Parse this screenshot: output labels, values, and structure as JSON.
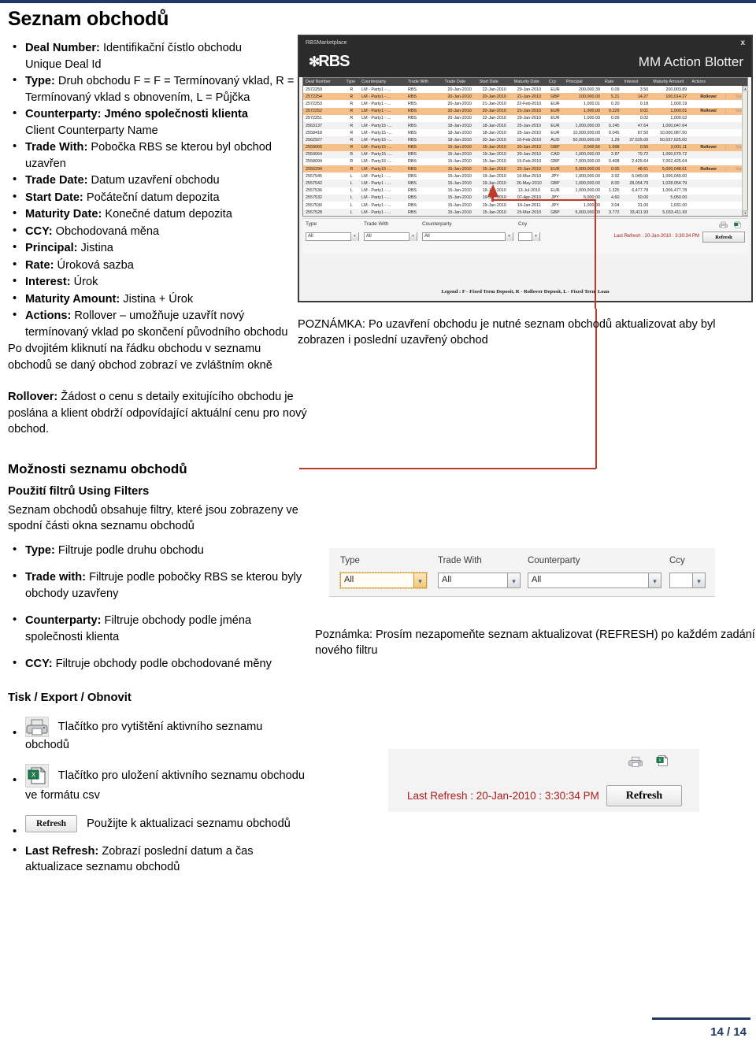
{
  "document": {
    "title": "Seznam obchodů",
    "page_number": "14 / 14"
  },
  "deal_list_bullets": [
    {
      "term": "Deal Number:",
      "desc": " Identifikační čístlo obchodu",
      "extra": "Unique Deal Id"
    },
    {
      "term": "Type:",
      "desc": " Druh obchodu F = F = Termínovaný vklad, R = Termínovaný vklad s obnovením, L = Půjčka",
      "extra": ""
    },
    {
      "term": "Counterparty: Jméno společnosti klienta",
      "desc": "",
      "extra": "Client Counterparty Name"
    },
    {
      "term": "Trade With:",
      "desc": " Pobočka RBS se kterou byl obchod uzavřen",
      "extra": ""
    },
    {
      "term": "Trade Date:",
      "desc": " Datum uzavření obchodu",
      "extra": ""
    },
    {
      "term": "Start Date:",
      "desc": " Počáteční datum depozita",
      "extra": ""
    },
    {
      "term": "Maturity Date:",
      "desc": " Konečné datum depozita",
      "extra": ""
    },
    {
      "term": "CCY:",
      "desc": " Obchodovaná měna",
      "extra": ""
    },
    {
      "term": "Principal:",
      "desc": " Jistina",
      "extra": ""
    },
    {
      "term": "Rate:",
      "desc": " Úroková sazba",
      "extra": ""
    },
    {
      "term": "Interest:",
      "desc": " Úrok",
      "extra": ""
    },
    {
      "term": "Maturity Amount:",
      "desc": " Jistina + Úrok",
      "extra": ""
    },
    {
      "term": "Actions:",
      "desc": " Rollover – umožňuje uzavřít nový termínovaný vklad po skončení původního obchodu",
      "extra": ""
    }
  ],
  "doubleclick_note": "Po dvojitém kliknutí na řádku obchodu v seznamu obchodů se daný obchod zobrazí ve zvláštním okně",
  "rollover_note": {
    "term": "Rollover:",
    "text": " Žádost o cenu s detaily exitujícího obchodu je poslána a klient obdrží odpovídající aktuální cenu pro nový obchod."
  },
  "note_top_right": "POZNÁMKA: Po uzavření obchodu je nutné seznam obchodů aktualizovat aby byl zobrazen i poslední uzavřený obchod",
  "options_section": {
    "heading": "Možnosti seznamu obchodů",
    "subheading": "Použití filtrů Using Filters",
    "intro": "Seznam obchodů obsahuje filtry, které jsou zobrazeny ve spodní části okna seznamu obchodů",
    "bullets": [
      {
        "term": "Type:",
        "desc": " Filtruje podle druhu obchodu"
      },
      {
        "term": "Trade with:",
        "desc": " Filtruje podle pobočky RBS se kterou byly obchody uzavřeny"
      },
      {
        "term": "Counterparty:",
        "desc": " Filtruje obchody podle jména společnosti klienta"
      },
      {
        "term": "CCY:",
        "desc": " Filtruje obchody podle obchodované měny"
      }
    ]
  },
  "note_mid_right": "Poznámka: Prosím nezapomeňte seznam aktualizovat (REFRESH) po každém zadání nového filtru",
  "print_section": {
    "heading": "Tisk / Export / Obnovit",
    "items": [
      {
        "icon": "printer-icon",
        "label": "Tlačítko pro vytištění aktivního seznamu obchodů"
      },
      {
        "icon": "csv-export-icon",
        "label": "Tlačítko pro uložení aktivního seznamu obchodu ve formátu csv"
      },
      {
        "icon": "refresh-button",
        "button_label": "Refresh",
        "label": "Použijte k aktualizaci seznamu obchodů"
      }
    ],
    "last_refresh_bullet": {
      "term": "Last Refresh:",
      "desc": " Zobrazí poslední datum a čas aktualizace seznamu obchodů"
    }
  },
  "blotter": {
    "window_title": "RBSMarketplace",
    "close_label": "x",
    "brand_mark": "✻",
    "brand_text": "RBS",
    "screen_title": "MM Action Blotter",
    "columns": [
      "Deal Number",
      "Type",
      "Counterparty",
      "Trade With",
      "Trade Date",
      "Start Date",
      "Maturity Date",
      "Ccy",
      "Principal",
      "Rate",
      "Interest",
      "Maturity Amount",
      "Actions"
    ],
    "rows": [
      {
        "deal": "2572259",
        "type": "R",
        "cp": "LM - Party1 - ...",
        "tw": "RBS",
        "td": "20-Jan-2010",
        "sd": "22-Jan-2010",
        "md": "29-Jan-2010",
        "ccy": "EUR",
        "principal": "200,000.39",
        "rate": "0.09",
        "interest": "3.50",
        "matamt": "200,003.89",
        "rollover": "",
        "mature": "",
        "hl": false
      },
      {
        "deal": "2572254",
        "type": "R",
        "cp": "LM - Party1 - ...",
        "tw": "RBS",
        "td": "20-Jan-2010",
        "sd": "20-Jan-2010",
        "md": "21-Jan-2010",
        "ccy": "GBP",
        "principal": "100,000.00",
        "rate": "5.21",
        "interest": "14.27",
        "matamt": "100,014.27",
        "rollover": "Rollover",
        "mature": "Mature",
        "hl": true
      },
      {
        "deal": "2572253",
        "type": "R",
        "cp": "LM - Party1 - ...",
        "tw": "RBS",
        "td": "20-Jan-2010",
        "sd": "21-Jan-2010",
        "md": "22-Feb-2010",
        "ccy": "EUR",
        "principal": "1,000.01",
        "rate": "0.20",
        "interest": "0.18",
        "matamt": "1,000.19",
        "rollover": "",
        "mature": "",
        "hl": false
      },
      {
        "deal": "2572252",
        "type": "R",
        "cp": "LM - Party1 - ...",
        "tw": "RBS",
        "td": "20-Jan-2010",
        "sd": "20-Jan-2010",
        "md": "21-Jan-2010",
        "ccy": "EUR",
        "principal": "1,000.00",
        "rate": "0.229",
        "interest": "0.01",
        "matamt": "1,000.01",
        "rollover": "Rollover",
        "mature": "Mature",
        "hl": true
      },
      {
        "deal": "2572251",
        "type": "R",
        "cp": "LM - Party1 - ...",
        "tw": "RBS",
        "td": "20-Jan-2010",
        "sd": "22-Jan-2010",
        "md": "29-Jan-2010",
        "ccy": "EUR",
        "principal": "1,000.00",
        "rate": "0.09",
        "interest": "0.02",
        "matamt": "1,000.02",
        "rollover": "",
        "mature": "",
        "hl": false
      },
      {
        "deal": "2563137",
        "type": "R",
        "cp": "LM - Party15 -...",
        "tw": "RBS",
        "td": "18-Jan-2010",
        "sd": "18-Jan-2010",
        "md": "25-Jan-2010",
        "ccy": "EUR",
        "principal": "1,000,000.00",
        "rate": "0.245",
        "interest": "47.64",
        "matamt": "1,000,047.64",
        "rollover": "",
        "mature": "",
        "hl": false
      },
      {
        "deal": "2558418",
        "type": "R",
        "cp": "LM - Party15 -...",
        "tw": "RBS",
        "td": "18-Jan-2010",
        "sd": "18-Jan-2010",
        "md": "25-Jan-2010",
        "ccy": "EUR",
        "principal": "10,000,000.00",
        "rate": "0.045",
        "interest": "87.50",
        "matamt": "10,000,087.50",
        "rollover": "",
        "mature": "",
        "hl": false
      },
      {
        "deal": "2562927",
        "type": "R",
        "cp": "LM - Party15 -...",
        "tw": "RBS",
        "td": "18-Jan-2010",
        "sd": "20-Jan-2010",
        "md": "10-Feb-2010",
        "ccy": "AUD",
        "principal": "50,000,000.00",
        "rate": "1.29",
        "interest": "37,625.00",
        "matamt": "50,037,625.00",
        "rollover": "",
        "mature": "",
        "hl": false
      },
      {
        "deal": "2559065",
        "type": "R",
        "cp": "LM - Party15 -...",
        "tw": "RBS",
        "td": "15-Jan-2010",
        "sd": "15-Jan-2010",
        "md": "20-Jan-2010",
        "ccy": "GBP",
        "principal": "2,000.56",
        "rate": "1.998",
        "interest": "0.55",
        "matamt": "2,001.11",
        "rollover": "Rollover",
        "mature": "Mature",
        "hl": true
      },
      {
        "deal": "2559064",
        "type": "R",
        "cp": "LM - Party15 -...",
        "tw": "RBS",
        "td": "15-Jan-2010",
        "sd": "19-Jan-2010",
        "md": "20-Jan-2010",
        "ccy": "CAD",
        "principal": "1,000,000.00",
        "rate": "2.87",
        "interest": "79.72",
        "matamt": "1,000,079.72",
        "rollover": "",
        "mature": "",
        "hl": false
      },
      {
        "deal": "2558094",
        "type": "R",
        "cp": "LM - Party15 -...",
        "tw": "RBS",
        "td": "15-Jan-2010",
        "sd": "15-Jan-2010",
        "md": "15-Feb-2010",
        "ccy": "GBP",
        "principal": "7,000,000.00",
        "rate": "0.408",
        "interest": "2,425.64",
        "matamt": "7,002,425.64",
        "rollover": "",
        "mature": "",
        "hl": false
      },
      {
        "deal": "2556294",
        "type": "R",
        "cp": "LM - Party15 -...",
        "tw": "RBS",
        "td": "15-Jan-2010",
        "sd": "15-Jan-2010",
        "md": "22-Jan-2010",
        "ccy": "EUR",
        "principal": "5,000,000.00",
        "rate": "0.05",
        "interest": "48.61",
        "matamt": "5,000,048.61",
        "rollover": "Rollover",
        "mature": "Mature",
        "hl": true
      },
      {
        "deal": "2557545",
        "type": "L",
        "cp": "LM - Party1 - ...",
        "tw": "RBS",
        "td": "15-Jan-2010",
        "sd": "19-Jan-2010",
        "md": "16-Mar-2010",
        "ccy": "JPY",
        "principal": "1,000,000.00",
        "rate": "3.92",
        "interest": "6,049.00",
        "matamt": "1,006,049.00",
        "rollover": "",
        "mature": "",
        "hl": false
      },
      {
        "deal": "2557542",
        "type": "L",
        "cp": "LM - Party1 - ...",
        "tw": "RBS",
        "td": "15-Jan-2010",
        "sd": "19-Jan-2010",
        "md": "26-May-2010",
        "ccy": "GBP",
        "principal": "1,000,000.00",
        "rate": "8.00",
        "interest": "28,054.79",
        "matamt": "1,028,054.79",
        "rollover": "",
        "mature": "",
        "hl": false
      },
      {
        "deal": "2557536",
        "type": "L",
        "cp": "LM - Party1 - ...",
        "tw": "RBS",
        "td": "15-Jan-2010",
        "sd": "19-Jan-2010",
        "md": "13-Jul-2010",
        "ccy": "EUR",
        "principal": "1,000,000.00",
        "rate": "1.325",
        "interest": "6,477.78",
        "matamt": "1,006,477.78",
        "rollover": "",
        "mature": "",
        "hl": false
      },
      {
        "deal": "2557532",
        "type": "L",
        "cp": "LM - Party1 - ...",
        "tw": "RBS",
        "td": "15-Jan-2010",
        "sd": "19-Jan-2010",
        "md": "07-Apr-2010",
        "ccy": "JPY",
        "principal": "5,000.00",
        "rate": "4.60",
        "interest": "50.00",
        "matamt": "5,050.00",
        "rollover": "",
        "mature": "",
        "hl": false
      },
      {
        "deal": "2557530",
        "type": "L",
        "cp": "LM - Party1 - ...",
        "tw": "RBS",
        "td": "15-Jan-2010",
        "sd": "19-Jan-2010",
        "md": "19-Jan-2011",
        "ccy": "JPY",
        "principal": "1,000.00",
        "rate": "3.04",
        "interest": "31.00",
        "matamt": "1,031.00",
        "rollover": "",
        "mature": "",
        "hl": false
      },
      {
        "deal": "2557528",
        "type": "L",
        "cp": "LM - Party1 - ...",
        "tw": "RBS",
        "td": "15-Jan-2010",
        "sd": "15-Jan-2010",
        "md": "15-Mar-2010",
        "ccy": "GBP",
        "principal": "5,000,000.00",
        "rate": "3.772",
        "interest": "33,411.93",
        "matamt": "5,033,411.93",
        "rollover": "",
        "mature": "",
        "hl": false
      }
    ],
    "filters": {
      "labels": [
        "Type",
        "Trade With",
        "Counterparty",
        "Ccy"
      ],
      "values": [
        "All",
        "All",
        "All",
        ""
      ],
      "chevron": "▾"
    },
    "last_refresh": "Last Refresh : 20-Jan-2010 : 3:30:34 PM",
    "refresh_label": "Refresh",
    "legend": "Legend : F - Fixed Term Deposit, R - Rollover Deposit, L - Fixed Term Loan"
  },
  "filter_shot": {
    "labels": [
      "Type",
      "Trade With",
      "Counterparty",
      "Ccy"
    ],
    "values": [
      "All",
      "All",
      "All",
      ""
    ],
    "chevron": "▾"
  },
  "refresh_shot": {
    "last_refresh": "Last Refresh : 20-Jan-2010 : 3:30:34 PM",
    "refresh_label": "Refresh"
  },
  "colors": {
    "rule_blue": "#1F3864",
    "callout_red": "#c0392b",
    "highlight_row": "#f7c08a",
    "last_refresh_red": "#b01b1b"
  }
}
